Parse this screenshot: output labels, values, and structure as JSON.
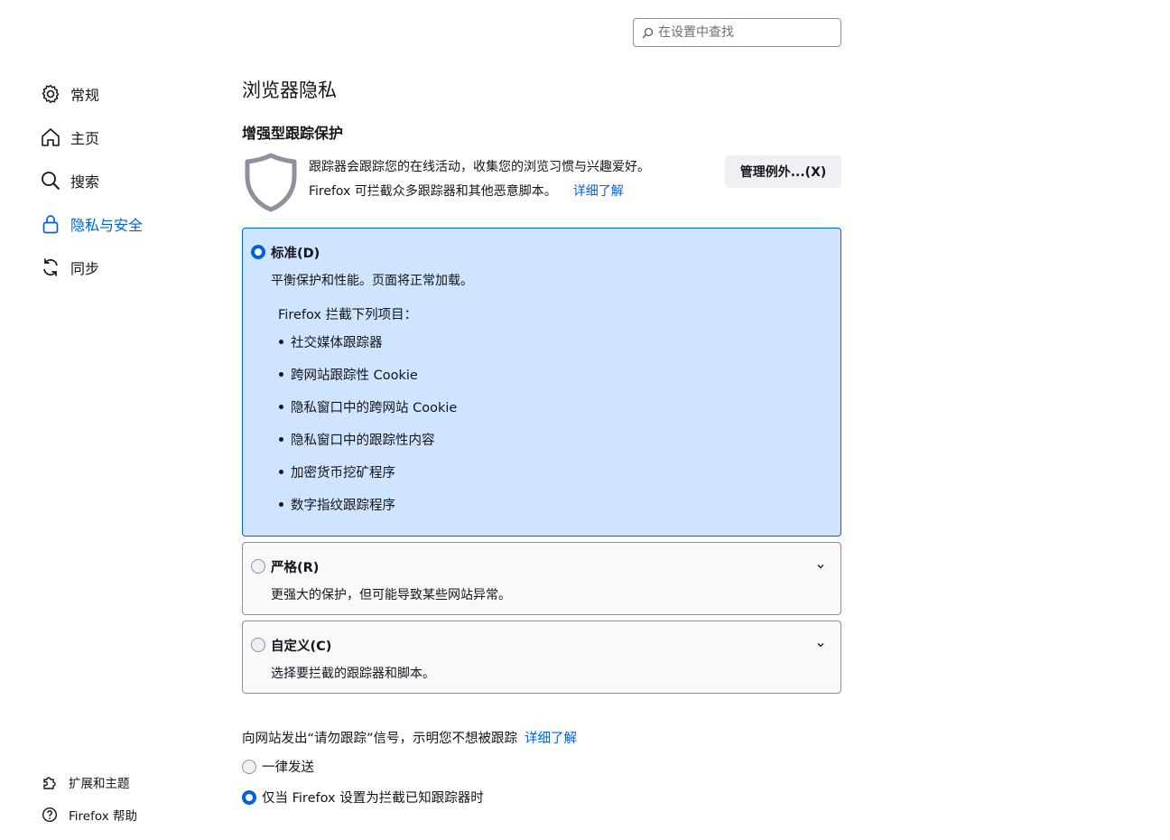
{
  "search": {
    "placeholder": "在设置中查找"
  },
  "sidebar": {
    "items": [
      {
        "label": "常规",
        "icon": "gear-icon"
      },
      {
        "label": "主页",
        "icon": "home-icon"
      },
      {
        "label": "搜索",
        "icon": "search-icon"
      },
      {
        "label": "隐私与安全",
        "icon": "lock-icon",
        "active": true
      },
      {
        "label": "同步",
        "icon": "sync-icon"
      }
    ],
    "footer": [
      {
        "label": "扩展和主题",
        "icon": "puzzle-icon"
      },
      {
        "label": "Firefox 帮助",
        "icon": "help-icon"
      }
    ]
  },
  "page": {
    "title": "浏览器隐私"
  },
  "etp": {
    "title": "增强型跟踪保护",
    "desc_line1": "跟踪器会跟踪您的在线活动，收集您的浏览习惯与兴趣爱好。",
    "desc_line2": "Firefox 可拦截众多跟踪器和其他恶意脚本。",
    "learn_more": "详细了解",
    "manage_exceptions": "管理例外...(X)"
  },
  "standard": {
    "label": "标准(D)",
    "desc": "平衡保护和性能。页面将正常加载。",
    "blocks_title": "Firefox 拦截下列项目：",
    "items": [
      "社交媒体跟踪器",
      "跨网站跟踪性 Cookie",
      "隐私窗口中的跨网站 Cookie",
      "隐私窗口中的跟踪性内容",
      "加密货币挖矿程序",
      "数字指纹跟踪程序"
    ]
  },
  "strict": {
    "label": "严格(R)",
    "desc": "更强大的保护，但可能导致某些网站异常。"
  },
  "custom": {
    "label": "自定义(C)",
    "desc": "选择要拦截的跟踪器和脚本。"
  },
  "dnt": {
    "text": "向网站发出“请勿跟踪”信号，示明您不想被跟踪",
    "learn_more": "详细了解",
    "always": "一律发送",
    "only_when": "仅当 Firefox 设置为拦截已知跟踪器时",
    "selected": "only_when"
  },
  "colors": {
    "accent": "#0061e0",
    "selected_card": "#cfe4fe",
    "text": "#15141a"
  }
}
